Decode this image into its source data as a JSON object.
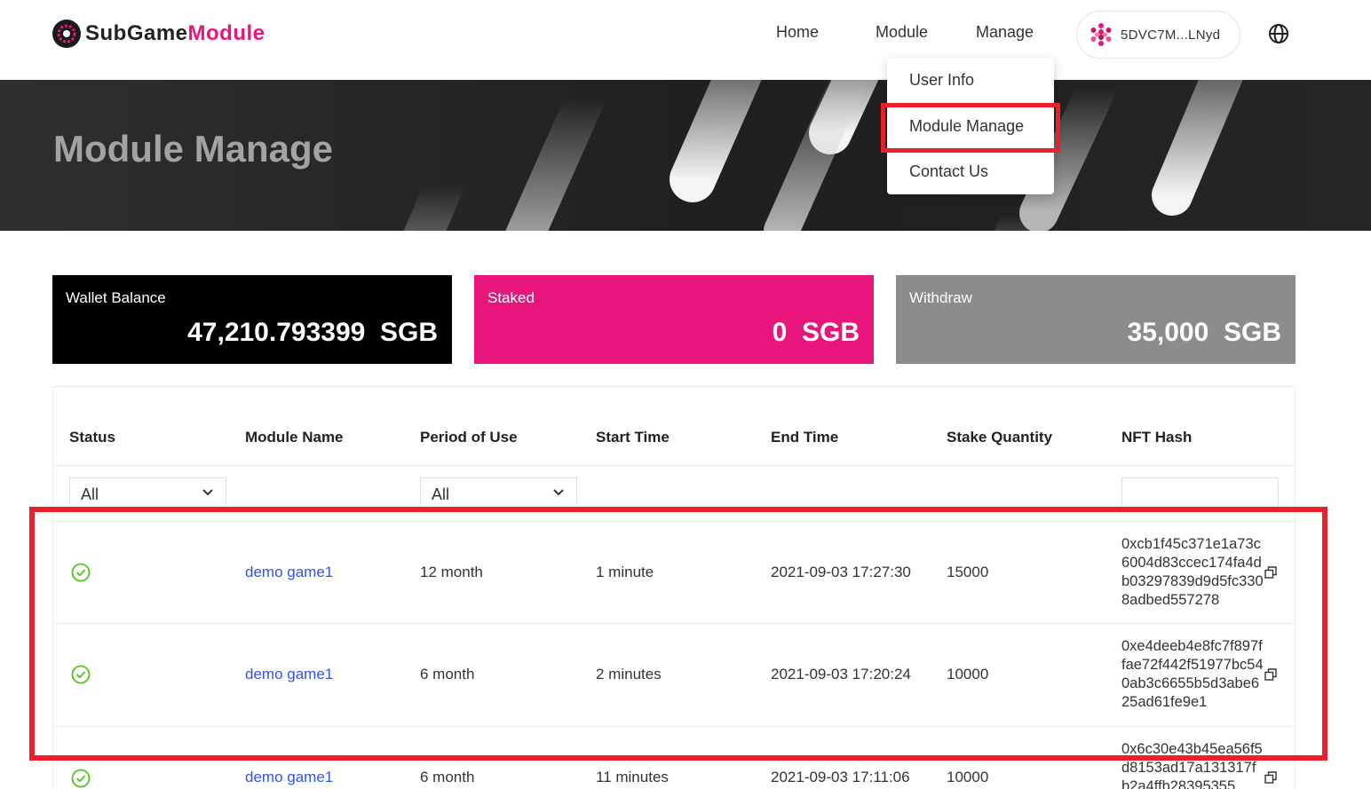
{
  "header": {
    "logo": {
      "part1": "SubGame",
      "part2": "Module"
    },
    "nav": {
      "home": "Home",
      "module": "Module",
      "manage": "Manage"
    },
    "account_address": "5DVC7M...LNyd"
  },
  "dropdown": {
    "items": [
      "User Info",
      "Module Manage",
      "Contact Us"
    ],
    "highlighted": "Module Manage"
  },
  "banner": {
    "title": "Module Manage"
  },
  "cards": [
    {
      "label": "Wallet Balance",
      "value": "47,210.793399",
      "unit": "SGB"
    },
    {
      "label": "Staked",
      "value": "0",
      "unit": "SGB"
    },
    {
      "label": "Withdraw",
      "value": "35,000",
      "unit": "SGB"
    }
  ],
  "table": {
    "columns": [
      "Status",
      "Module Name",
      "Period of Use",
      "Start Time",
      "End Time",
      "Stake Quantity",
      "NFT Hash"
    ],
    "filters": {
      "status": "All",
      "period": "All"
    },
    "rows": [
      {
        "name": "demo game1",
        "period": "12 month",
        "start": "1 minute",
        "end": "2021-09-03 17:27:30",
        "stake": "15000",
        "hash": "0xcb1f45c371e1a73c6004d83ccec174fa4db03297839d9d5fc3308adbed557278"
      },
      {
        "name": "demo game1",
        "period": "6 month",
        "start": "2 minutes",
        "end": "2021-09-03 17:20:24",
        "stake": "10000",
        "hash": "0xe4deeb4e8fc7f897ffae72f442f51977bc540ab3c6655b5d3abe625ad61fe9e1"
      },
      {
        "name": "demo game1",
        "period": "6 month",
        "start": "11 minutes",
        "end": "2021-09-03 17:11:06",
        "stake": "10000",
        "hash": "0x6c30e43b45ea56f5d8153ad17a131317fb2a4ffb28395355"
      }
    ]
  },
  "colors": {
    "brand_pink": "#e8157d",
    "link_blue": "#2f54eb",
    "status_green": "#52c41a",
    "highlight_red": "#e8212b"
  }
}
